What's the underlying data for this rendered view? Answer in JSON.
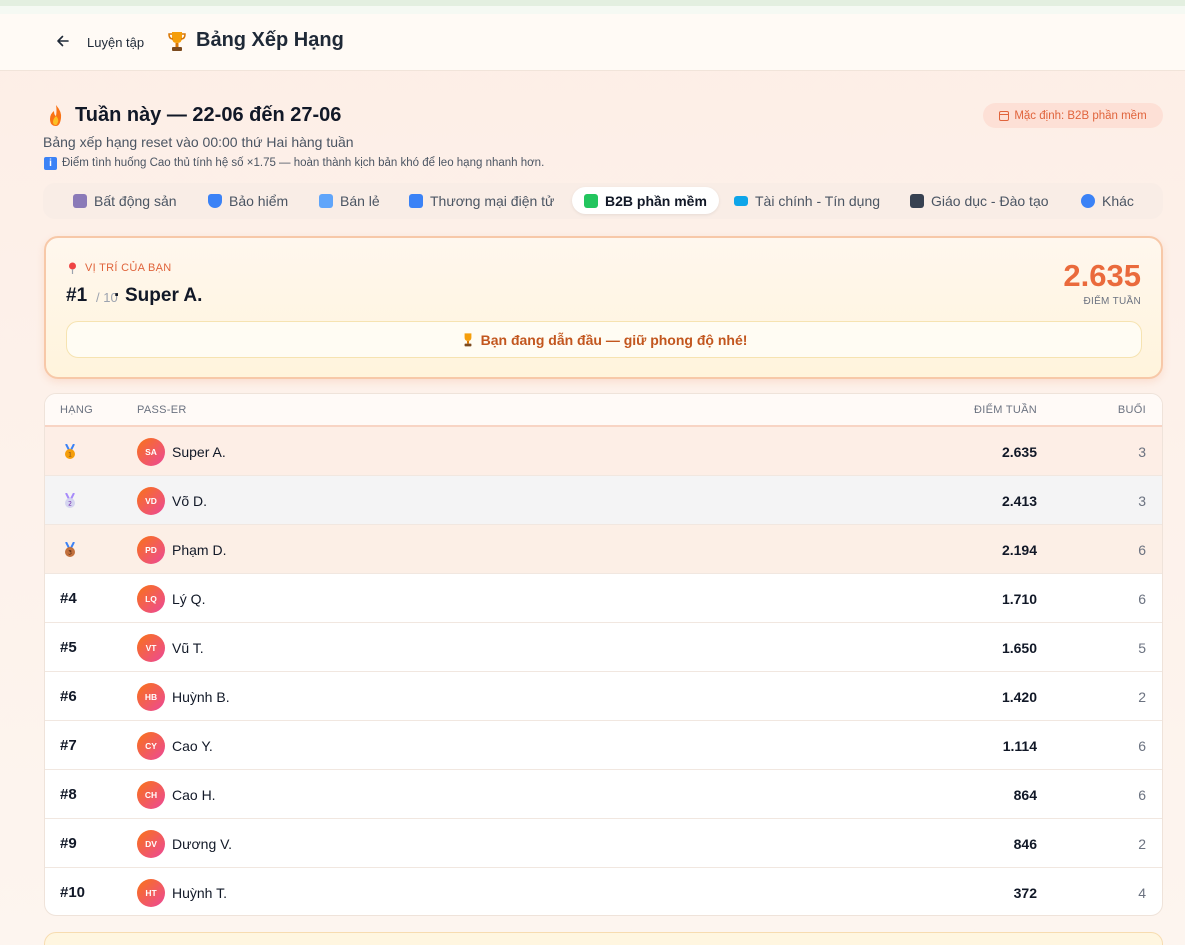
{
  "header": {
    "back_label": "Luyện tập",
    "title": "Bảng Xếp Hạng"
  },
  "week": {
    "title": "Tuần này — 22-06 đến 27-06",
    "reset_note": "Bảng xếp hạng reset vào 00:00 thứ Hai hàng tuần",
    "bonus_note": "Điểm tình huống Cao thủ tính hệ số ×1.75 — hoàn thành kịch bản khó để leo hạng nhanh hơn.",
    "info_glyph": "i",
    "default_badge": "Mặc định: B2B phần mềm"
  },
  "tabs": [
    {
      "label": "Bất động sản",
      "icon": "building-icon",
      "color": "#8b7ab8"
    },
    {
      "label": "Bảo hiểm",
      "icon": "shield-icon",
      "color": "#3b82f6"
    },
    {
      "label": "Bán lẻ",
      "icon": "shopping-bag-icon",
      "color": "#60a5fa"
    },
    {
      "label": "Thương mại điện tử",
      "icon": "laptop-icon",
      "color": "#3b82f6"
    },
    {
      "label": "B2B phần mềm",
      "icon": "puzzle-icon",
      "color": "#22c55e",
      "active": true
    },
    {
      "label": "Tài chính - Tín dụng",
      "icon": "credit-card-icon",
      "color": "#0ea5e9"
    },
    {
      "label": "Giáo dục - Đào tạo",
      "icon": "graduation-cap-icon",
      "color": "#374151"
    },
    {
      "label": "Khác",
      "icon": "globe-icon",
      "color": "#3b82f6"
    }
  ],
  "your_position": {
    "label": "VỊ TRÍ CỦA BẠN",
    "rank": "#1",
    "total": "/ 10",
    "separator": "·",
    "name": "Super A.",
    "score": "2.635",
    "score_label": "ĐIỂM TUẦN",
    "banner": "Bạn đang dẫn đầu — giữ phong độ nhé!"
  },
  "table": {
    "headers": {
      "rank": "HẠNG",
      "player": "PASS-ER",
      "score": "ĐIỂM TUẦN",
      "sessions": "BUỔI"
    },
    "rows": [
      {
        "rank": "1",
        "medal": "gold",
        "initials": "SA",
        "name": "Super A.",
        "score": "2.635",
        "sessions": "3"
      },
      {
        "rank": "2",
        "medal": "silver",
        "initials": "VD",
        "name": "Võ D.",
        "score": "2.413",
        "sessions": "3"
      },
      {
        "rank": "3",
        "medal": "bronze",
        "initials": "PD",
        "name": "Phạm D.",
        "score": "2.194",
        "sessions": "6"
      },
      {
        "rank": "#4",
        "initials": "LQ",
        "name": "Lý Q.",
        "score": "1.710",
        "sessions": "6"
      },
      {
        "rank": "#5",
        "initials": "VT",
        "name": "Vũ T.",
        "score": "1.650",
        "sessions": "5"
      },
      {
        "rank": "#6",
        "initials": "HB",
        "name": "Huỳnh B.",
        "score": "1.420",
        "sessions": "2"
      },
      {
        "rank": "#7",
        "initials": "CY",
        "name": "Cao Y.",
        "score": "1.114",
        "sessions": "6"
      },
      {
        "rank": "#8",
        "initials": "CH",
        "name": "Cao H.",
        "score": "864",
        "sessions": "6"
      },
      {
        "rank": "#9",
        "initials": "DV",
        "name": "Dương V.",
        "score": "846",
        "sessions": "2"
      },
      {
        "rank": "#10",
        "initials": "HT",
        "name": "Huỳnh T.",
        "score": "372",
        "sessions": "4"
      }
    ]
  },
  "colors": {
    "accent": "#ea6a3c",
    "medal_gold": "#f59e0b",
    "medal_silver": "#a78bfa",
    "medal_bronze": "#c2703d"
  }
}
